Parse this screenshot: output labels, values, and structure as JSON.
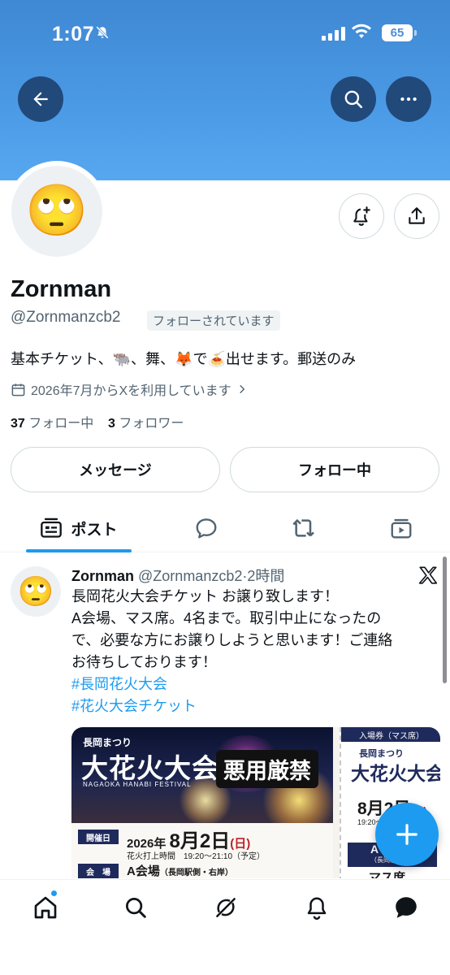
{
  "status_bar": {
    "time": "1:07",
    "battery": "65"
  },
  "header": {
    "back_icon": "arrow-left-icon",
    "search_icon": "search-icon",
    "more_icon": "ellipsis-icon",
    "banner_color": "#4b9ae6"
  },
  "profile": {
    "avatar_emoji": "🙄",
    "display_name": "Zornman",
    "handle": "@Zornmanzcb2",
    "follows_you_badge": "フォローされています",
    "bio": "基本チケット、🐃、舞、🦊で🍝出せます。郵送のみ",
    "joined": "2026年7月からXを利用しています",
    "following_count": "37",
    "following_label": "フォロー中",
    "followers_count": "3",
    "followers_label": "フォロワー"
  },
  "actions": {
    "message_label": "メッセージ",
    "following_label": "フォロー中"
  },
  "tabs": {
    "posts_label": "ポスト",
    "accent": "#1d9bf0"
  },
  "post": {
    "author_name": "Zornman",
    "author_handle": "@Zornmanzcb2",
    "time": "·2時間",
    "lines": [
      "長岡花火大会チケット お譲り致します！",
      "A会場、マス席。4名まで。取引中止になったの",
      "で、必要な方にお譲りしようと思います！ご連絡",
      "お待ちしております！"
    ],
    "hashtags": [
      "#長岡花火大会",
      "#花火大会チケット"
    ],
    "image": {
      "festival_small": "長岡まつり",
      "title": "大花火大会",
      "title_en": "NAGAOKA HANABI FESTIVAL",
      "watermark": "悪用厳禁",
      "date_tag": "開催日",
      "date_year": "2026年",
      "date_month_day": "8月2日",
      "date_weekday": "(日)",
      "time_info": "花火打上時間　19:20～21:10（予定）",
      "venue_tag": "会　場",
      "venue": "A会場",
      "venue_detail": "（長岡駅側・右岸）",
      "stub_header": "入場券（マス席）",
      "stub_small": "長岡まつり",
      "stub_title": "大花火大会",
      "stub_date": "8月2日",
      "stub_weekday": "(日)",
      "stub_time": "19:20～",
      "stub_block": "A",
      "stub_block_sub": "（長岡駅側",
      "stub_seat": "マス席"
    }
  },
  "bottom_nav": [
    "home-icon",
    "search-icon",
    "grok-icon",
    "notifications-icon",
    "messages-icon"
  ]
}
